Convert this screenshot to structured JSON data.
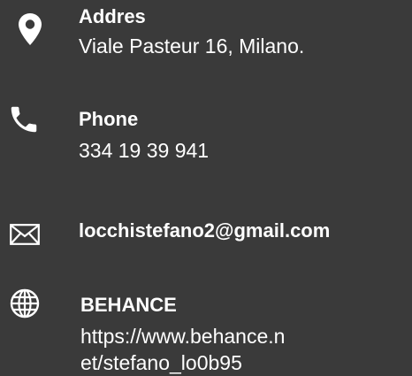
{
  "contacts": {
    "address": {
      "icon": "map-pin-icon",
      "label": "Addres",
      "value": "Viale Pasteur 16, Milano."
    },
    "phone": {
      "icon": "phone-icon",
      "label": "Phone",
      "value": "334 19 39 941"
    },
    "email": {
      "icon": "envelope-icon",
      "label": "locchistefano2@gmail.com"
    },
    "behance": {
      "icon": "globe-icon",
      "label": "BEHANCE",
      "value_line1": "https://www.behance.n",
      "value_line2": "et/stefano_lo0b95"
    }
  },
  "colors": {
    "background": "#3a3a3a",
    "text": "#ffffff"
  }
}
